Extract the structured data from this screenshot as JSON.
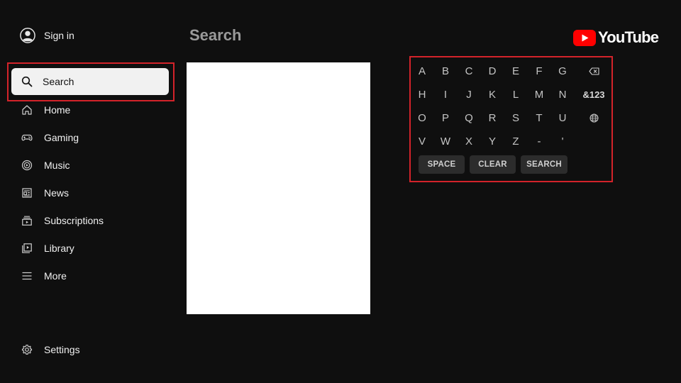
{
  "sidebar": {
    "sign_in": "Sign in",
    "search": "Search",
    "items": [
      {
        "label": "Home",
        "icon": "home-icon"
      },
      {
        "label": "Gaming",
        "icon": "gamepad-icon"
      },
      {
        "label": "Music",
        "icon": "music-icon"
      },
      {
        "label": "News",
        "icon": "news-icon"
      },
      {
        "label": "Subscriptions",
        "icon": "subscriptions-icon"
      },
      {
        "label": "Library",
        "icon": "library-icon"
      },
      {
        "label": "More",
        "icon": "menu-icon"
      }
    ],
    "settings": "Settings"
  },
  "main": {
    "title": "Search"
  },
  "logo": {
    "text": "YouTube",
    "color": "#ff0000"
  },
  "keyboard": {
    "rows": [
      [
        "A",
        "B",
        "C",
        "D",
        "E",
        "F",
        "G"
      ],
      [
        "H",
        "I",
        "J",
        "K",
        "L",
        "M",
        "N"
      ],
      [
        "O",
        "P",
        "Q",
        "R",
        "S",
        "T",
        "U"
      ],
      [
        "V",
        "W",
        "X",
        "Y",
        "Z",
        "-",
        "'"
      ]
    ],
    "symbols_key": "&123",
    "backspace_icon": "backspace-icon",
    "language_icon": "globe-icon",
    "space_label": "SPACE",
    "clear_label": "CLEAR",
    "search_label": "SEARCH"
  },
  "colors": {
    "background": "#0f0f0f",
    "focus_outline": "#d3232a",
    "selected_pill": "#f1f1f1"
  }
}
